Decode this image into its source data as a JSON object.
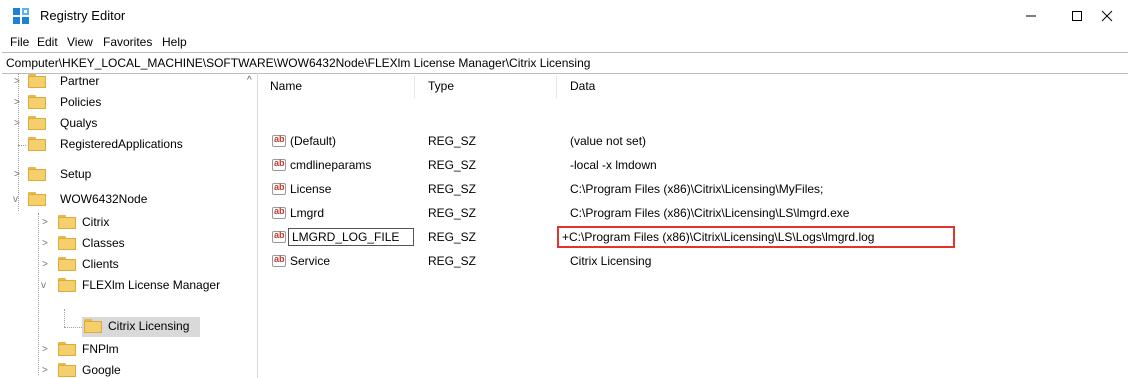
{
  "window": {
    "title": "Registry Editor"
  },
  "menu": [
    "File",
    "Edit",
    "View",
    "Favorites",
    "Help"
  ],
  "address": "Computer\\HKEY_LOCAL_MACHINE\\SOFTWARE\\WOW6432Node\\FLEXlm License Manager\\Citrix Licensing",
  "tree": {
    "items": [
      {
        "label": "Partner",
        "expanded": false
      },
      {
        "label": "Policies",
        "expanded": false
      },
      {
        "label": "Qualys",
        "expanded": false
      },
      {
        "label": "RegisteredApplications",
        "expanded": false
      },
      {
        "label": "Setup",
        "expanded": false
      },
      {
        "label": "WOW6432Node",
        "expanded": true
      },
      {
        "label": "Citrix",
        "expanded": false
      },
      {
        "label": "Classes",
        "expanded": false
      },
      {
        "label": "Clients",
        "expanded": false
      },
      {
        "label": "FLEXlm License Manager",
        "expanded": true
      },
      {
        "label": "Citrix Licensing",
        "selected": true
      },
      {
        "label": "FNPlm",
        "expanded": false
      },
      {
        "label": "Google",
        "expanded": false
      }
    ]
  },
  "columns": {
    "name": "Name",
    "type": "Type",
    "data": "Data"
  },
  "values": [
    {
      "name": "(Default)",
      "type": "REG_SZ",
      "data": "(value not set)"
    },
    {
      "name": "cmdlineparams",
      "type": "REG_SZ",
      "data": "-local -x lmdown"
    },
    {
      "name": "License",
      "type": "REG_SZ",
      "data": "C:\\Program Files (x86)\\Citrix\\Licensing\\MyFiles;"
    },
    {
      "name": "Lmgrd",
      "type": "REG_SZ",
      "data": "C:\\Program Files (x86)\\Citrix\\Licensing\\LS\\lmgrd.exe"
    },
    {
      "name": "LMGRD_LOG_FILE",
      "type": "REG_SZ",
      "data": "+C:\\Program Files (x86)\\Citrix\\Licensing\\LS\\Logs\\lmgrd.log",
      "highlighted": true,
      "editing": true
    },
    {
      "name": "Service",
      "type": "REG_SZ",
      "data": "Citrix Licensing"
    }
  ],
  "colors": {
    "highlight": "#e0342d",
    "folder": "#f5cf6b"
  },
  "icons": {
    "app": "registry-editor-icon",
    "minimize": "minimize-icon",
    "maximize": "maximize-icon",
    "close": "close-icon"
  }
}
